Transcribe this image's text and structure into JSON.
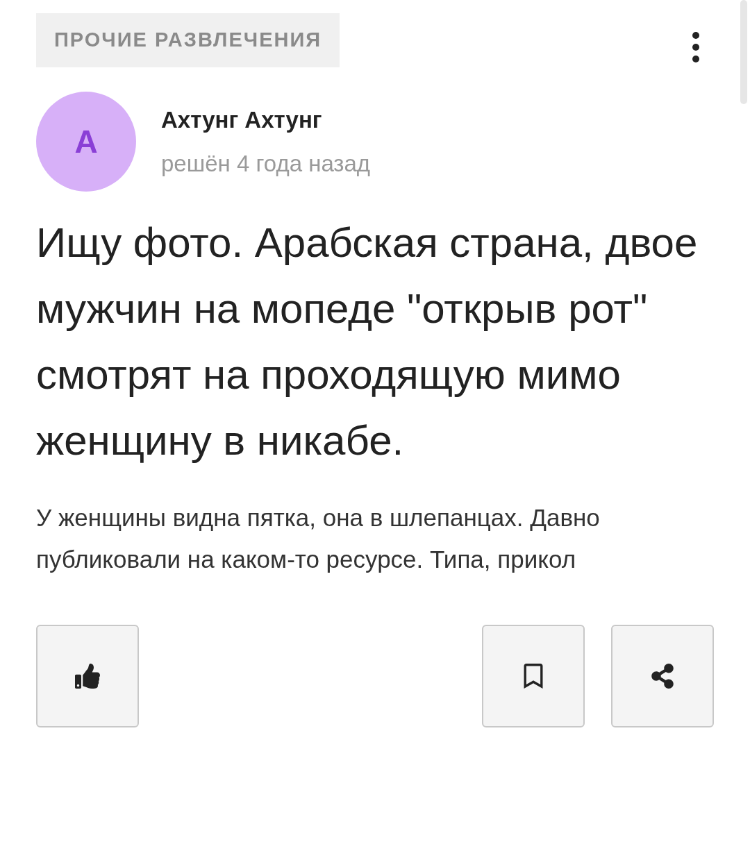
{
  "category": "ПРОЧИЕ РАЗВЛЕЧЕНИЯ",
  "author": {
    "initial": "А",
    "name": "Ахтунг Ахтунг",
    "status": "решён 4 года назад"
  },
  "title": "Ищу фото. Арабская страна, двое мужчин на мопеде \"открыв рот\" смотрят на проходящую мимо женщину в никабе.",
  "body": "У женщины видна пятка, она в шлепанцах. Давно публиковали на каком-то ресурсе. Типа, прикол",
  "actions": [
    {
      "kind": "like"
    },
    {
      "kind": "bookmark"
    },
    {
      "kind": "share"
    }
  ]
}
